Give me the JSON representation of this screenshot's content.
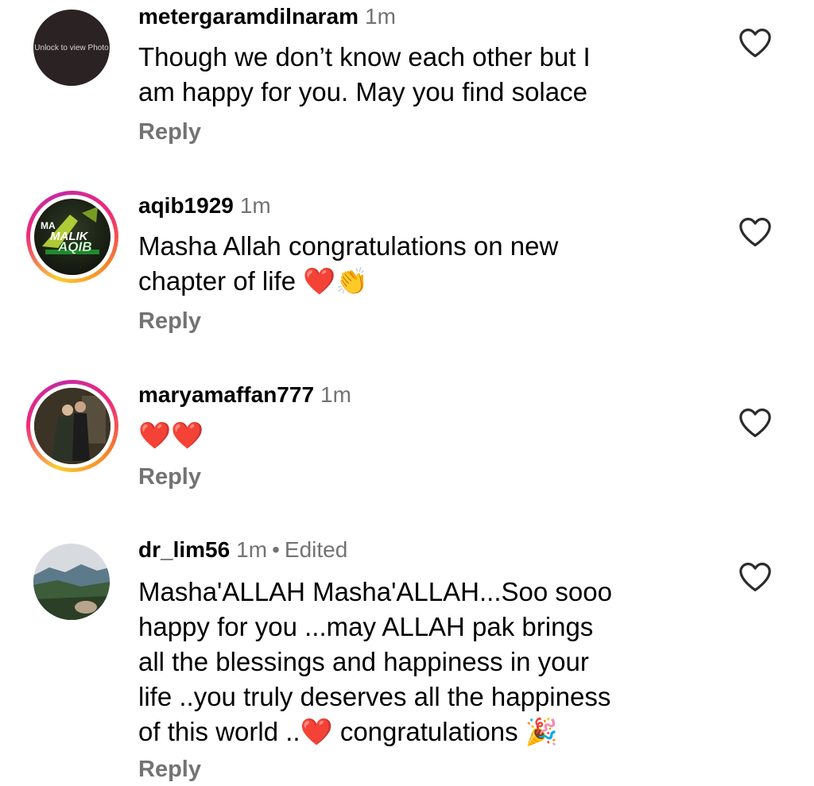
{
  "comments": [
    {
      "username": "metergaramdilnaram",
      "time": "1m",
      "avatar_locked_text": "Unlock to view Photo",
      "text_lines": [
        "Though we don’t know each other but I",
        "am happy for you. May you find solace"
      ],
      "reply_label": "Reply"
    },
    {
      "username": "aqib1929",
      "time": "1m",
      "avatar_text_1": "MALIK",
      "avatar_text_2": "AQIB",
      "avatar_text_3": "MA",
      "text_lines": [
        "Masha Allah congratulations on new",
        "chapter of life ❤️👏"
      ],
      "reply_label": "Reply"
    },
    {
      "username": "maryamaffan777",
      "time": "1m",
      "text_lines": [
        "❤️❤️"
      ],
      "reply_label": "Reply"
    },
    {
      "username": "dr_lim56",
      "time": "1m",
      "edited": "Edited",
      "text_lines": [
        "Masha'ALLAH Masha'ALLAH...Soo sooo",
        "happy for you ...may ALLAH pak brings",
        "all the blessings and happiness in your",
        "life ..you truly deserves all the happiness",
        "of this world ..❤️ congratulations 🎉"
      ],
      "reply_label": "Reply"
    }
  ],
  "icons": {
    "like": "heart-outline-icon"
  },
  "colors": {
    "meta": "#737373",
    "text": "#000000",
    "heart_emoji": "#e0202b"
  }
}
